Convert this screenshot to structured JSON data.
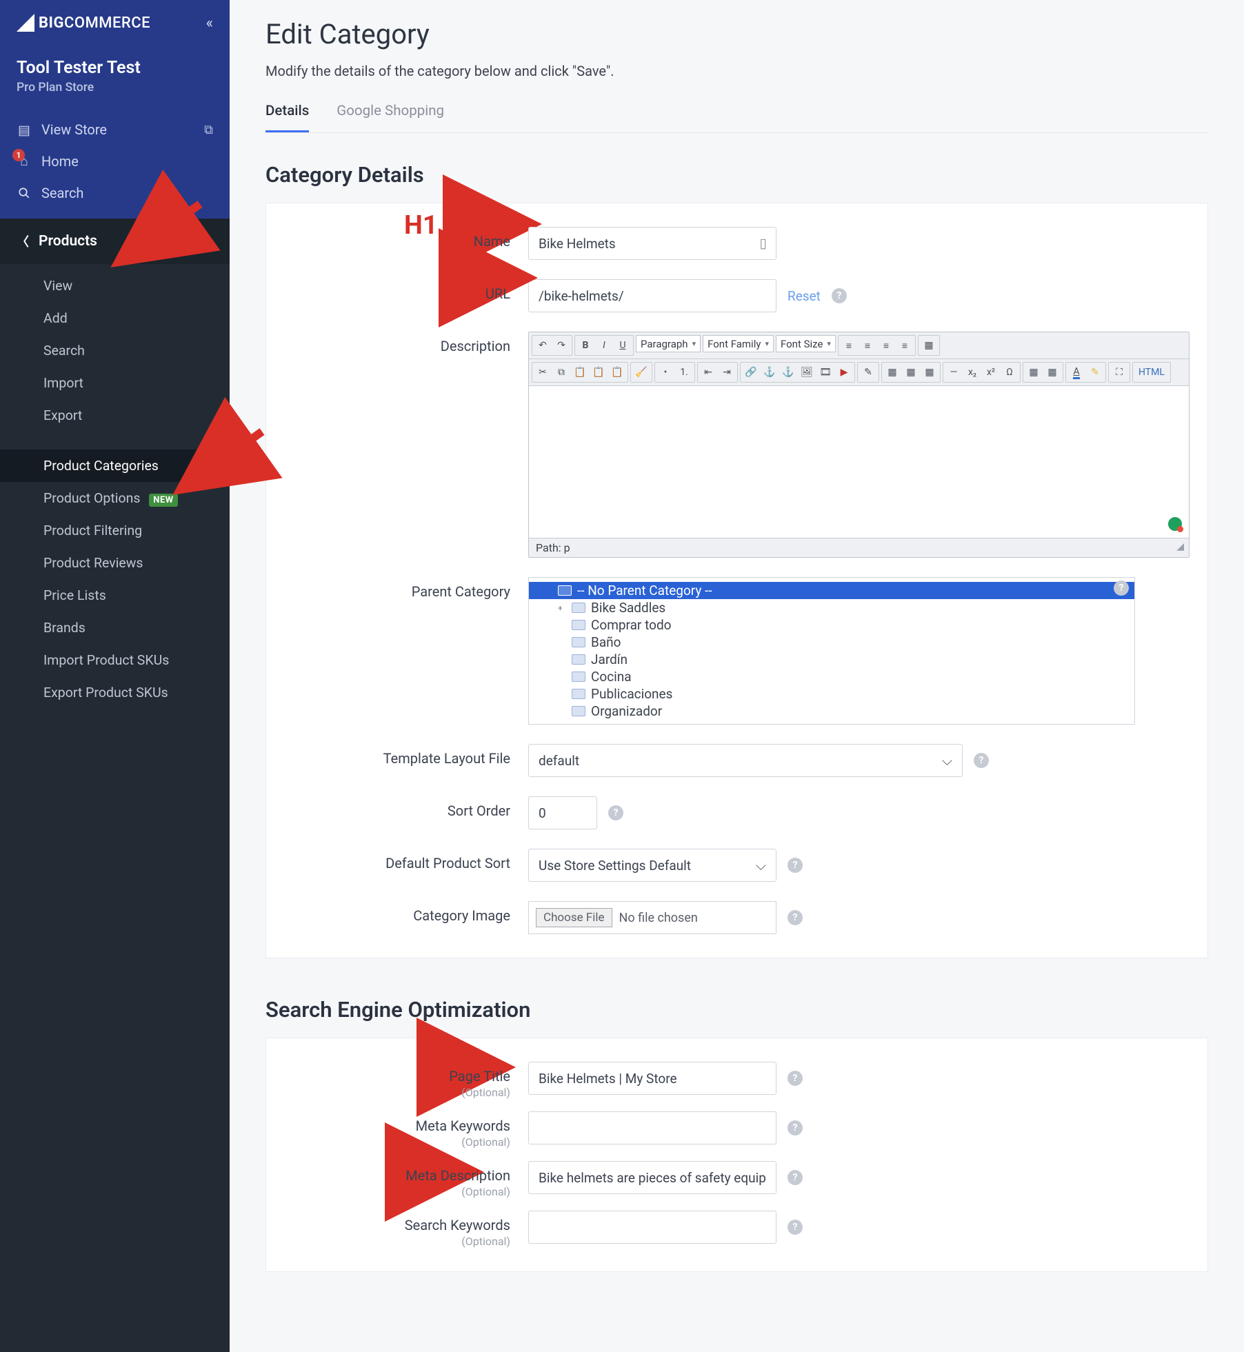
{
  "brand": {
    "big": "BIG",
    "rest": "COMMERCE"
  },
  "store": {
    "name": "Tool Tester Test",
    "plan": "Pro Plan Store"
  },
  "topnav": {
    "view_store": "View Store",
    "home": "Home",
    "home_badge": "1",
    "search": "Search"
  },
  "products_section": {
    "title": "Products"
  },
  "subnav": {
    "view": "View",
    "add": "Add",
    "search": "Search",
    "import": "Import",
    "export": "Export",
    "categories": "Product Categories",
    "options": "Product Options",
    "new_pill": "NEW",
    "filtering": "Product Filtering",
    "reviews": "Product Reviews",
    "pricelists": "Price Lists",
    "brands": "Brands",
    "import_skus": "Import Product SKUs",
    "export_skus": "Export Product SKUs"
  },
  "page": {
    "title": "Edit Category",
    "subtitle": "Modify the details of the category below and click \"Save\"."
  },
  "tabs": {
    "details": "Details",
    "google": "Google Shopping"
  },
  "details": {
    "heading": "Category Details",
    "labels": {
      "name": "Name",
      "url": "URL",
      "description": "Description",
      "parent": "Parent Category",
      "template": "Template Layout File",
      "sort": "Sort Order",
      "default_sort": "Default Product Sort",
      "image": "Category Image"
    },
    "name_value": "Bike Helmets",
    "url_value": "/bike-helmets/",
    "reset": "Reset",
    "editor": {
      "path": "Path: p",
      "dropdowns": {
        "para": "Paragraph",
        "family": "Font Family",
        "size": "Font Size"
      }
    },
    "parent_tree": [
      {
        "label": "-- No Parent Category --",
        "selected": true,
        "child": false,
        "expander": ""
      },
      {
        "label": "Bike Saddles",
        "child": true,
        "expander": "+"
      },
      {
        "label": "Comprar todo",
        "child": true,
        "expander": ""
      },
      {
        "label": "Baño",
        "child": true,
        "expander": ""
      },
      {
        "label": "Jardín",
        "child": true,
        "expander": ""
      },
      {
        "label": "Cocina",
        "child": true,
        "expander": ""
      },
      {
        "label": "Publicaciones",
        "child": true,
        "expander": ""
      },
      {
        "label": "Organizador",
        "child": true,
        "expander": ""
      }
    ],
    "template_value": "default",
    "sort_value": "0",
    "default_sort_value": "Use Store Settings Default",
    "choose_file": "Choose File",
    "no_file": "No file chosen"
  },
  "seo": {
    "heading": "Search Engine Optimization",
    "optional": "(Optional)",
    "labels": {
      "page_title": "Page Title",
      "meta_keywords": "Meta Keywords",
      "meta_description": "Meta Description",
      "search_keywords": "Search Keywords"
    },
    "page_title_value": "Bike Helmets | My Store",
    "meta_keywords_value": "",
    "meta_description_value": "Bike helmets are pieces of safety equipm",
    "search_keywords_value": ""
  },
  "annotation": {
    "h1": "H1"
  }
}
